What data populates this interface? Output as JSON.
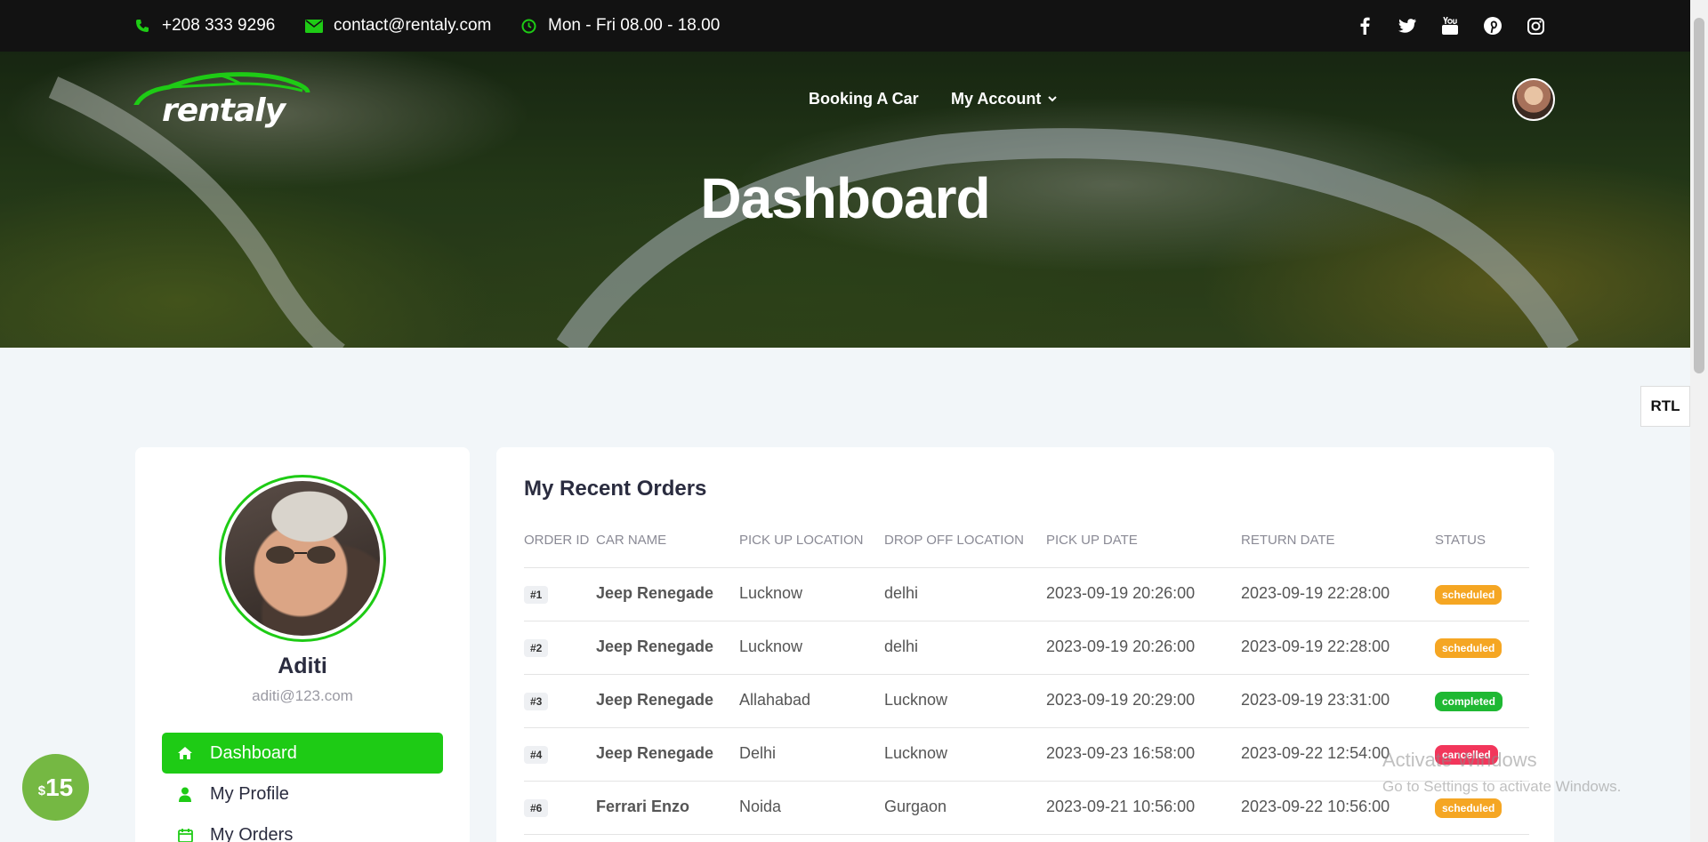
{
  "topbar": {
    "phone": "+208 333 9296",
    "email": "contact@rentaly.com",
    "hours": "Mon - Fri 08.00 - 18.00",
    "social_icons": [
      "facebook-icon",
      "twitter-icon",
      "youtube-icon",
      "pinterest-icon",
      "instagram-icon"
    ]
  },
  "brand": {
    "logo_text": "rentaly",
    "accent": "#1ecb15"
  },
  "nav": {
    "booking": "Booking A Car",
    "account": "My Account"
  },
  "hero": {
    "title": "Dashboard"
  },
  "rtl_label": "RTL",
  "profile": {
    "name": "Aditi",
    "email": "aditi@123.com"
  },
  "menu": [
    {
      "label": "Dashboard",
      "icon": "home-icon",
      "active": true
    },
    {
      "label": "My Profile",
      "icon": "user-icon",
      "active": false
    },
    {
      "label": "My Orders",
      "icon": "calendar-icon",
      "active": false
    }
  ],
  "orders": {
    "title": "My Recent Orders",
    "headers": [
      "ORDER ID",
      "CAR NAME",
      "PICK UP LOCATION",
      "DROP OFF LOCATION",
      "PICK UP DATE",
      "RETURN DATE",
      "STATUS"
    ],
    "rows": [
      {
        "id": "#1",
        "car": "Jeep Renegade",
        "pickup": "Lucknow",
        "dropoff": "delhi",
        "pickup_date": "2023-09-19 20:26:00",
        "return_date": "2023-09-19 22:28:00",
        "status": "scheduled",
        "status_color": "#f5a623"
      },
      {
        "id": "#2",
        "car": "Jeep Renegade",
        "pickup": "Lucknow",
        "dropoff": "delhi",
        "pickup_date": "2023-09-19 20:26:00",
        "return_date": "2023-09-19 22:28:00",
        "status": "scheduled",
        "status_color": "#f5a623"
      },
      {
        "id": "#3",
        "car": "Jeep Renegade",
        "pickup": "Allahabad",
        "dropoff": "Lucknow",
        "pickup_date": "2023-09-19 20:29:00",
        "return_date": "2023-09-19 23:31:00",
        "status": "completed",
        "status_color": "#1fb833"
      },
      {
        "id": "#4",
        "car": "Jeep Renegade",
        "pickup": "Delhi",
        "dropoff": "Lucknow",
        "pickup_date": "2023-09-23 16:58:00",
        "return_date": "2023-09-22 12:54:00",
        "status": "cancelled",
        "status_color": "#f2365b"
      },
      {
        "id": "#6",
        "car": "Ferrari Enzo",
        "pickup": "Noida",
        "dropoff": "Gurgaon",
        "pickup_date": "2023-09-21 10:56:00",
        "return_date": "2023-09-22 10:56:00",
        "status": "scheduled",
        "status_color": "#f5a623"
      }
    ]
  },
  "coin": {
    "currency": "$",
    "amount": "15"
  },
  "watermark": {
    "line1": "Activate Windows",
    "line2": "Go to Settings to activate Windows."
  }
}
